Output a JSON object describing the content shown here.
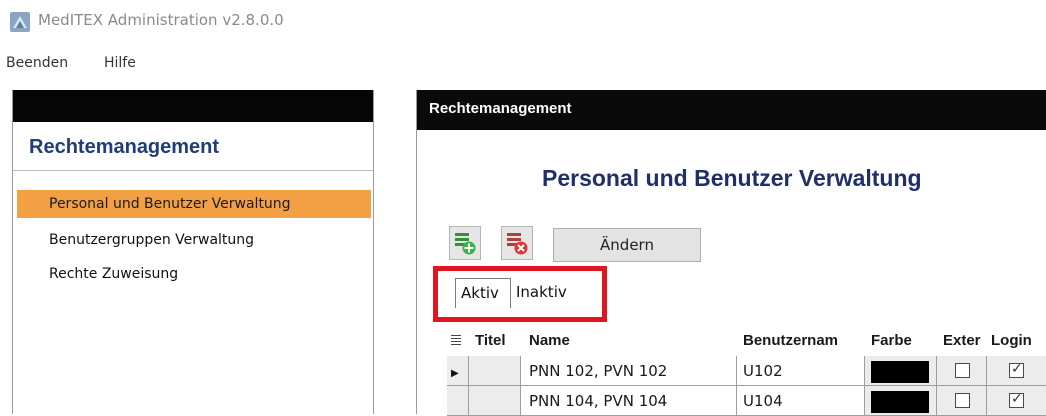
{
  "window": {
    "title": "MedITEX Administration v2.8.0.0"
  },
  "menu": {
    "items": [
      "Beenden",
      "Hilfe"
    ]
  },
  "left_panel": {
    "title": "Rechtemanagement",
    "nav_items": [
      {
        "label": "Personal und Benutzer Verwaltung",
        "active": true
      },
      {
        "label": "Benutzergruppen Verwaltung",
        "active": false
      },
      {
        "label": "Rechte Zuweisung",
        "active": false
      }
    ],
    "active_color": "#f2a043"
  },
  "right_panel": {
    "header": "Rechtemanagement",
    "title": "Personal und Benutzer Verwaltung",
    "toolbar": {
      "edit_label": "Ändern"
    },
    "tabs": [
      "Aktiv",
      "Inaktiv"
    ],
    "table": {
      "columns": [
        "Titel",
        "Name",
        "Benutzernam",
        "Farbe",
        "Exter",
        "Login"
      ],
      "rows": [
        {
          "selected": true,
          "titel": "",
          "name": "PNN 102, PVN 102",
          "user": "U102",
          "farbe": "#000000",
          "extern": false,
          "login": true
        },
        {
          "selected": false,
          "titel": "",
          "name": "PNN 104, PVN 104",
          "user": "U104",
          "farbe": "#000000",
          "extern": false,
          "login": true
        }
      ]
    },
    "highlight_color": "#e2141f"
  }
}
